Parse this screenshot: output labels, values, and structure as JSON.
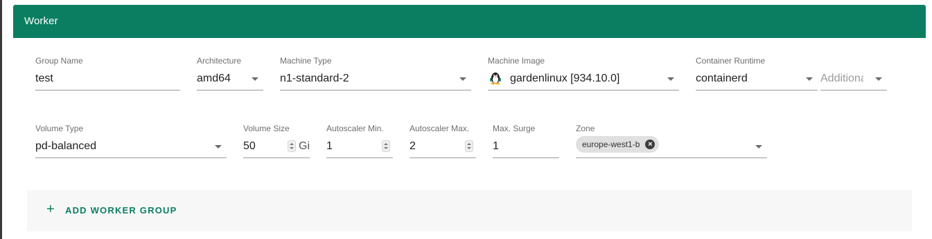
{
  "card": {
    "title": "Worker"
  },
  "row1": {
    "group_name": {
      "label": "Group Name",
      "value": "test"
    },
    "architecture": {
      "label": "Architecture",
      "value": "amd64"
    },
    "machine_type": {
      "label": "Machine Type",
      "value": "n1-standard-2"
    },
    "machine_image": {
      "label": "Machine Image",
      "value": "gardenlinux [934.10.0]",
      "icon": "tux-penguin-icon"
    },
    "container_runtime": {
      "label": "Container Runtime",
      "value": "containerd"
    },
    "additional": {
      "placeholder": "Additiona"
    }
  },
  "row2": {
    "volume_type": {
      "label": "Volume Type",
      "value": "pd-balanced"
    },
    "volume_size": {
      "label": "Volume Size",
      "value": "50",
      "suffix": "Gi"
    },
    "autoscaler_min": {
      "label": "Autoscaler Min.",
      "value": "1"
    },
    "autoscaler_max": {
      "label": "Autoscaler Max.",
      "value": "2"
    },
    "max_surge": {
      "label": "Max. Surge",
      "value": "1"
    },
    "zone": {
      "label": "Zone",
      "chips": [
        "europe-west1-b"
      ]
    }
  },
  "actions": {
    "add_worker_group": "ADD WORKER GROUP",
    "add_icon": "+"
  },
  "colors": {
    "accent": "#0b7e62",
    "header_text": "#ffffff",
    "footer_bg": "#f7f7f7"
  }
}
